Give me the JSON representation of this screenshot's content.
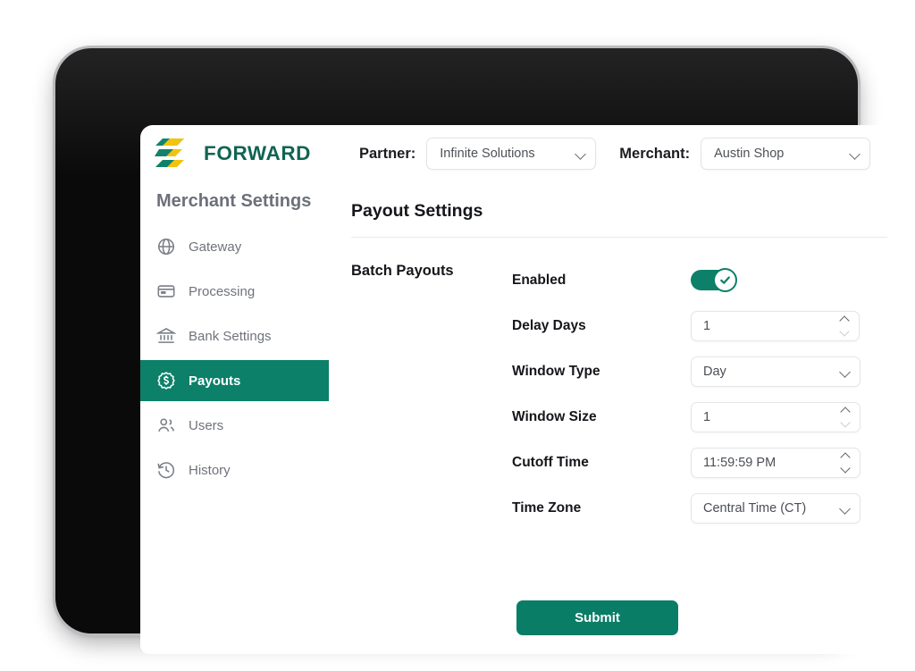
{
  "brand": {
    "name": "FORWARD",
    "logo_icon": "forward-logo-icon",
    "green": "#0c6150",
    "yellow": "#f2c20a"
  },
  "topbar": {
    "partner": {
      "label": "Partner:",
      "value": "Infinite Solutions",
      "chevron_icon": "chevron-down-icon"
    },
    "merchant": {
      "label": "Merchant:",
      "value": "Austin Shop",
      "chevron_icon": "chevron-down-icon"
    }
  },
  "sidebar": {
    "title": "Merchant Settings",
    "active_color": "#0c8069",
    "items": [
      {
        "label": "Gateway",
        "icon": "globe-icon",
        "active": false
      },
      {
        "label": "Processing",
        "icon": "credit-card-icon",
        "active": false
      },
      {
        "label": "Bank Settings",
        "icon": "bank-icon",
        "active": false
      },
      {
        "label": "Payouts",
        "icon": "dollar-badge-icon",
        "active": true
      },
      {
        "label": "Users",
        "icon": "users-icon",
        "active": false
      },
      {
        "label": "History",
        "icon": "history-icon",
        "active": false
      }
    ]
  },
  "content": {
    "page_title": "Payout Settings",
    "group_label": "Batch Payouts",
    "fields": {
      "enabled": {
        "label": "Enabled",
        "value": "on",
        "check_icon": "check-icon"
      },
      "delay_days": {
        "label": "Delay Days",
        "value": "1",
        "spinner_icon": "stepper-up-down-icon"
      },
      "window_type": {
        "label": "Window Type",
        "value": "Day",
        "chevron_icon": "chevron-down-icon"
      },
      "window_size": {
        "label": "Window Size",
        "value": "1",
        "spinner_icon": "stepper-up-down-icon"
      },
      "cutoff_time": {
        "label": "Cutoff Time",
        "value": "11:59:59 PM",
        "spinner_icon": "stepper-up-down-icon"
      },
      "time_zone": {
        "label": "Time Zone",
        "value": "Central Time (CT)",
        "chevron_icon": "chevron-down-icon"
      }
    },
    "submit_label": "Submit",
    "submit_color": "#0a7d66"
  }
}
